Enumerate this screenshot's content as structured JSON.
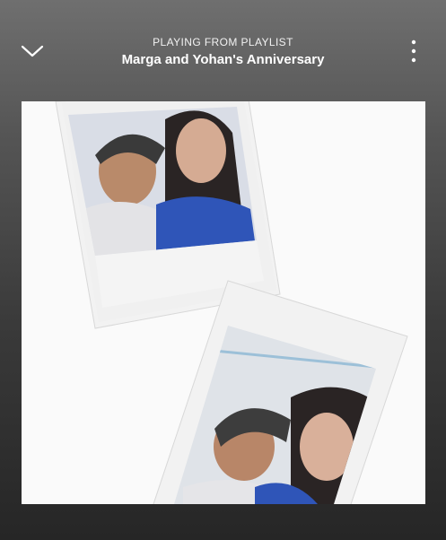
{
  "header": {
    "context_label": "PLAYING FROM PLAYLIST",
    "playlist_name": "Marga and Yohan's Anniversary",
    "collapse_icon": "chevron-down-icon",
    "menu_icon": "more-vertical-icon"
  },
  "artwork": {
    "description_icon": "album-art-image",
    "background_color": "#fafafa"
  },
  "colors": {
    "text": "#ffffff",
    "background_top": "#6f6f6f",
    "background_bottom": "#262626"
  }
}
